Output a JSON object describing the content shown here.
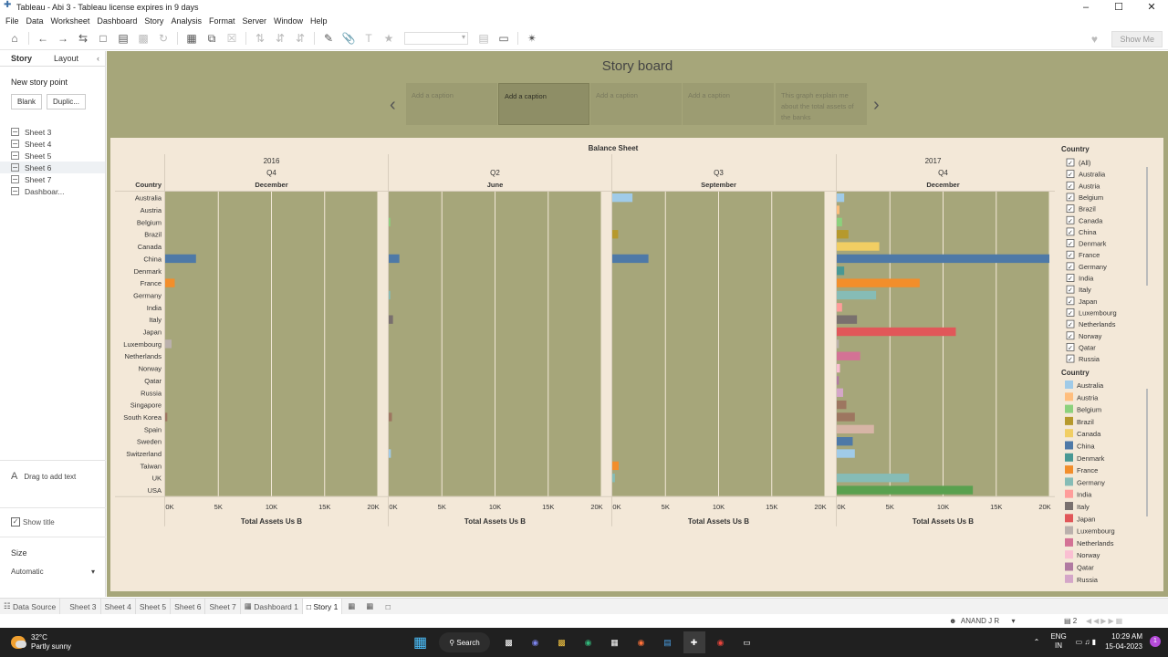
{
  "window": {
    "title": "Tableau - Abi 3 - Tableau license expires in 9 days",
    "controls": [
      "–",
      "☐",
      "✕"
    ]
  },
  "menu": [
    "File",
    "Data",
    "Worksheet",
    "Dashboard",
    "Story",
    "Analysis",
    "Format",
    "Server",
    "Window",
    "Help"
  ],
  "toolbar": {
    "show_me": "Show Me"
  },
  "left_pane": {
    "tabs": [
      "Story",
      "Layout"
    ],
    "new_story_point": "New story point",
    "blank_button": "Blank",
    "duplicate_button": "Duplic...",
    "sheets": [
      "Sheet 3",
      "Sheet 4",
      "Sheet 5",
      "Sheet 6",
      "Sheet 7",
      "Dashboar..."
    ],
    "drag_text": "Drag to add text",
    "show_title": "Show title",
    "size_label": "Size",
    "size_value": "Automatic"
  },
  "story": {
    "title": "Story board",
    "story_points": [
      "Add a caption",
      "Add a caption",
      "Add a caption",
      "Add a caption",
      "This graph explain me about the total assets of the banks"
    ],
    "active_point_index": 1
  },
  "chart_data": {
    "type": "bar",
    "orientation": "horizontal",
    "title": "Balance Sheet",
    "row_header": "Country",
    "xlabel": "Total Assets Us B",
    "xlim": [
      0,
      20000
    ],
    "xticks": [
      "0K",
      "5K",
      "10K",
      "15K",
      "20K"
    ],
    "grid": true,
    "categories": [
      "Australia",
      "Austria",
      "Belgium",
      "Brazil",
      "Canada",
      "China",
      "Denmark",
      "France",
      "Germany",
      "India",
      "Italy",
      "Japan",
      "Luxembourg",
      "Netherlands",
      "Norway",
      "Qatar",
      "Russia",
      "Singapore",
      "South Korea",
      "Spain",
      "Sweden",
      "Switzerland",
      "Taiwan",
      "UK",
      "USA"
    ],
    "colors": {
      "Australia": "#a0cbe8",
      "Austria": "#ffbe7d",
      "Belgium": "#8cd17d",
      "Brazil": "#b6992d",
      "Canada": "#f1ce63",
      "China": "#4e79a7",
      "Denmark": "#499894",
      "France": "#f28e2b",
      "Germany": "#86bcb6",
      "India": "#ff9d9a",
      "Italy": "#79706e",
      "Japan": "#e15759",
      "Luxembourg": "#bab0ac",
      "Netherlands": "#d37295",
      "Norway": "#fabfd2",
      "Qatar": "#b07aa1",
      "Russia": "#d4a6c8",
      "Singapore": "#9d7660",
      "South Korea": "#9d7660",
      "Spain": "#d7b5a6",
      "Sweden": "#4e79a7",
      "Switzerland": "#a0cbe8",
      "Taiwan": "#f28e2b",
      "UK": "#86bcb6",
      "USA": "#59a14f"
    },
    "panels": [
      {
        "year": "2016",
        "quarter": "Q4",
        "month": "December",
        "values": {
          "China": 2900,
          "France": 900,
          "Luxembourg": 600,
          "South Korea": 200
        }
      },
      {
        "year": "",
        "quarter": "Q2",
        "month": "June",
        "values": {
          "Belgium": 150,
          "China": 1000,
          "Germany": 150,
          "Italy": 400,
          "South Korea": 300,
          "Switzerland": 200
        }
      },
      {
        "year": "2017",
        "quarter": "Q3",
        "month": "September",
        "values": {
          "Australia": 1900,
          "Brazil": 550,
          "China": 3400,
          "Taiwan": 600,
          "UK": 250
        }
      },
      {
        "year": "",
        "quarter": "Q4",
        "month": "December",
        "values": {
          "Australia": 700,
          "Austria": 250,
          "Belgium": 500,
          "Brazil": 1100,
          "Canada": 4000,
          "China": 20000,
          "Denmark": 700,
          "France": 7800,
          "Germany": 3700,
          "India": 500,
          "Italy": 1900,
          "Japan": 11200,
          "Luxembourg": 200,
          "Netherlands": 2200,
          "Norway": 300,
          "Qatar": 200,
          "Russia": 600,
          "Singapore": 900,
          "South Korea": 1700,
          "Spain": 3500,
          "Sweden": 1500,
          "Switzerland": 1700,
          "UK": 6800,
          "USA": 12800
        }
      }
    ]
  },
  "filter": {
    "title": "Country",
    "items": [
      "(All)",
      "Australia",
      "Austria",
      "Belgium",
      "Brazil",
      "Canada",
      "China",
      "Denmark",
      "France",
      "Germany",
      "India",
      "Italy",
      "Japan",
      "Luxembourg",
      "Netherlands",
      "Norway",
      "Qatar",
      "Russia"
    ]
  },
  "legend": {
    "title": "Country",
    "items": [
      "Australia",
      "Austria",
      "Belgium",
      "Brazil",
      "Canada",
      "China",
      "Denmark",
      "France",
      "Germany",
      "India",
      "Italy",
      "Japan",
      "Luxembourg",
      "Netherlands",
      "Norway",
      "Qatar",
      "Russia"
    ]
  },
  "bottom_tabs": [
    "Data Source",
    "Sheet 3",
    "Sheet 4",
    "Sheet 5",
    "Sheet 6",
    "Sheet 7",
    "Dashboard 1",
    "Story 1"
  ],
  "active_bottom_tab": "Story 1",
  "status": {
    "user": "ANAND J R",
    "sheet_count": "2"
  },
  "taskbar": {
    "temperature": "32°C",
    "weather": "Partly sunny",
    "search": "Search",
    "lang_top": "ENG",
    "lang_bottom": "IN",
    "time": "10:29 AM",
    "date": "15-04-2023",
    "notification_count": "1"
  }
}
